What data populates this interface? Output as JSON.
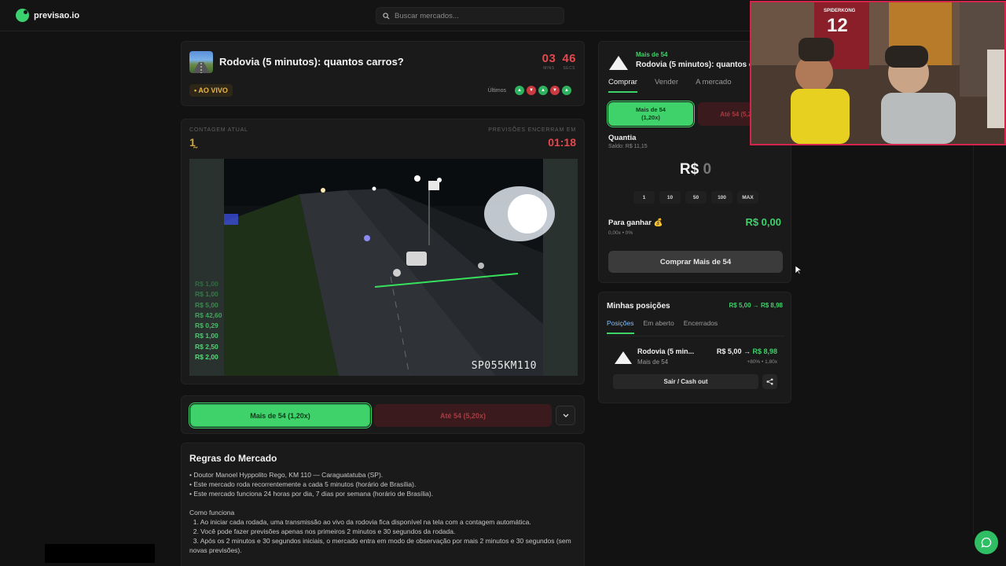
{
  "brand": {
    "name": "previsao.io",
    "color": "#3bd16f"
  },
  "search": {
    "placeholder": "Buscar mercados..."
  },
  "market": {
    "title": "Rodovia (5 minutos): quantos carros?",
    "live_badge": "• AO VIVO",
    "timer": {
      "minutes": "03",
      "seconds": "46",
      "minutes_label": "MINS",
      "seconds_label": "SECS"
    },
    "recent": {
      "label": "Últimos",
      "results": [
        "up",
        "down",
        "up",
        "down",
        "up"
      ]
    }
  },
  "stream": {
    "count_label": "CONTAGEM ATUAL",
    "count_value": "1̰",
    "close_label": "PREVISÕES ENCERRAM EM",
    "close_value": "01:18",
    "camera_id": "SP055KM110",
    "trades": [
      {
        "text": "R$ 1,00",
        "color": "#2f6b3f"
      },
      {
        "text": "R$ 1,00",
        "color": "#357a47"
      },
      {
        "text": "R$ 5,00",
        "color": "#3c8a50"
      },
      {
        "text": "R$ 42,60",
        "color": "#44a35e"
      },
      {
        "text": "R$ 0,29",
        "color": "#4bb868"
      },
      {
        "text": "R$ 1,00",
        "color": "#4fc66f"
      },
      {
        "text": "R$ 2,50",
        "color": "#52d174"
      },
      {
        "text": "R$ 2,00",
        "color": "#55dc78"
      }
    ]
  },
  "bet_bar": {
    "yes_label": "Mais de 54  (1,20x)",
    "no_label": "Até 54  (5,20x)"
  },
  "rules": {
    "title": "Regras do Mercado",
    "lines": [
      "• Doutor Manoel Hyppolito Rego, KM 110 — Caraguatatuba (SP).",
      "• Este mercado roda recorrentemente a cada 5 minutos (horário de Brasília).",
      "• Este mercado funciona 24 horas por dia, 7 dias por semana (horário de Brasília)."
    ],
    "how_title": "Como funciona",
    "steps": [
      "  1. Ao iniciar cada rodada, uma transmissão ao vivo da rodovia fica disponível na tela com a contagem automática.",
      "  2. Você pode fazer previsões apenas nos primeiros 2 minutos e 30 segundos da rodada.",
      "  3. Após os 2 minutos e 30 segundos iniciais, o mercado entra em modo de observação por mais 2 minutos e 30 segundos (sem novas previsões)."
    ]
  },
  "trade_panel": {
    "side_label": "Mais de 54",
    "title": "Rodovia (5 minutos): quantos carros?",
    "tabs": [
      "Comprar",
      "Vender",
      "A mercado"
    ],
    "yes_choice_line1": "Mais de 54",
    "yes_choice_line2": "(1,20x)",
    "no_choice": "Até 54 (5,20x)",
    "qty_label": "Quantia",
    "balance": "Saldo: R$ 11,15",
    "amount_prefix": "R$",
    "amount_value": "0",
    "chips": [
      "1",
      "10",
      "50",
      "100",
      "MAX"
    ],
    "win_label": "Para ganhar 💰",
    "win_sub": "0,00x • 0%",
    "win_value": "R$ 0,00",
    "buy_button": "Comprar Mais de 54"
  },
  "positions": {
    "title": "Minhas posições",
    "total": "R$ 5,00 → R$ 8,98",
    "tabs": [
      "Posições",
      "Em aberto",
      "Encerrados"
    ],
    "row": {
      "name": "Rodovia (5 min...",
      "side": "Mais de 54",
      "value_from": "R$ 5,00 →",
      "value_to": "R$ 8,98",
      "stats": "+80% • 1,80x"
    },
    "cashout_label": "Sair / Cash out"
  },
  "webcam": {
    "jersey_name": "SPIDERKONG",
    "jersey_number": "12"
  },
  "colors": {
    "green": "#3fd16a",
    "red": "#e5484d",
    "gold": "#c9a441",
    "background": "#121212"
  }
}
